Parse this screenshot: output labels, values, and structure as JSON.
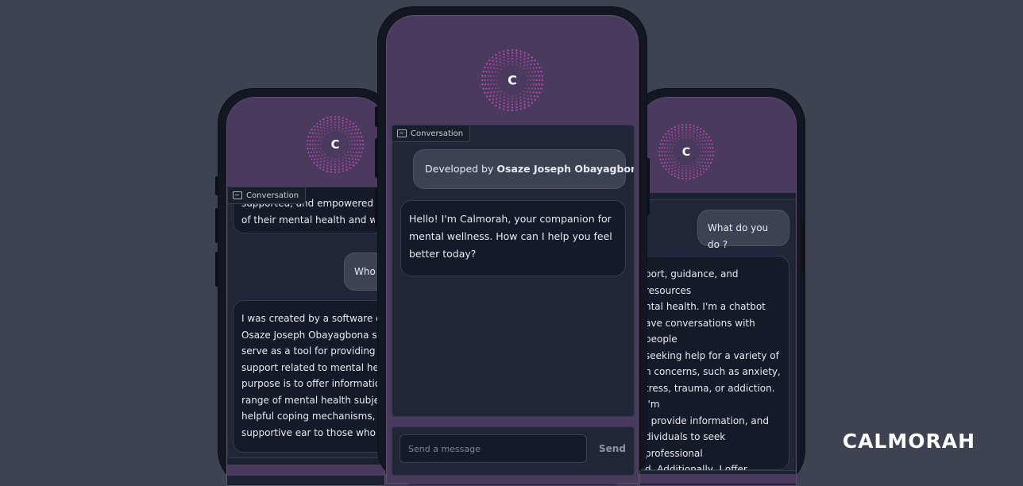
{
  "brand": {
    "wordmark": "CALMORAH",
    "color": "#ffffff"
  },
  "colors": {
    "background": "#3e4352",
    "header": "#4a3a5e",
    "accent_dots": "#d94fc4"
  },
  "logo_letter": "C",
  "conversation_label": "Conversation",
  "left_phone": {
    "bot_message_top": "supported, and empowered to ta\nof their mental health and well-b",
    "user_message": "Who c",
    "bot_message": "I was created by a software devel\nOsaze Joseph Obayagbona speci\nserve as a tool for providing assis\nsupport related to mental health\npurpose is to offer information o\nrange of mental health subjects,\nhelpful coping mechanisms, and\nsupportive ear to those who requ"
  },
  "center_phone": {
    "developer_prefix": "Developed by ",
    "developer_name": "Osaze Joseph Obayagbona",
    "bot_message": "Hello! I'm Calmorah, your companion for\nmental wellness. How can I help you feel\nbetter today?",
    "input_placeholder": "Send a message",
    "send_label": "Send"
  },
  "right_phone": {
    "user_message": "What do you do ?",
    "bot_message": "port, guidance, and resources\nntal health. I'm a chatbot\nave conversations with people\nseeking help for a variety of\nn concerns, such as anxiety,\ntress, trauma, or addiction. I'm\n, provide information, and\ndividuals to seek professional\nd. Additionally, I offer coping\nrapeutic techniques to manage\ntions and encourage personal\nelf-awareness. Overall, my goal"
  }
}
